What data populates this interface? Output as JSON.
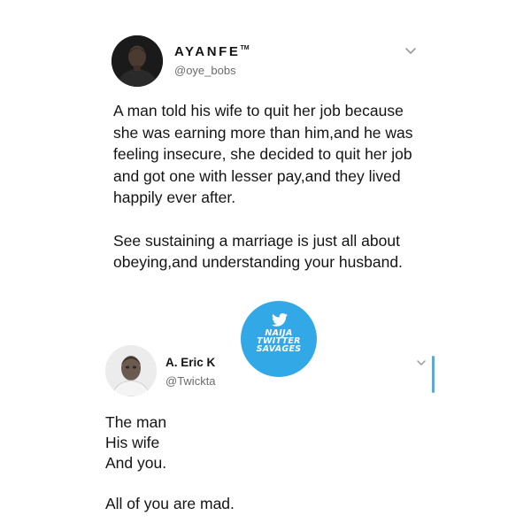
{
  "tweets": [
    {
      "author_name": "AYANFE",
      "author_name_mark": "TM",
      "handle": "@oye_bobs",
      "paragraphs": [
        "A man told his wife to quit her job because she was earning more than him,and he was feeling insecure, she decided to quit her job and got one with lesser pay,and they lived happily ever after.",
        "See sustaining a marriage is just all about obeying,and understanding your husband."
      ],
      "avatar_icon": "avatar-photo-icon",
      "menu_icon": "chevron-down-icon"
    },
    {
      "author_name": "A. Eric K",
      "handle": "@Twickta",
      "paragraphs": [
        "The man",
        "His wife",
        "And you.",
        "All of you are mad."
      ],
      "avatar_icon": "avatar-photo-icon",
      "menu_icon": "chevron-down-icon"
    }
  ],
  "watermark": {
    "line1": "NAIJA",
    "line2": "TWITTER",
    "line3": "SAVAGES",
    "icon": "twitter-bird-icon",
    "color": "#33a8e6"
  },
  "colors": {
    "text": "#141414",
    "handle": "#6b6b6b",
    "accent": "#5fa8cf"
  }
}
